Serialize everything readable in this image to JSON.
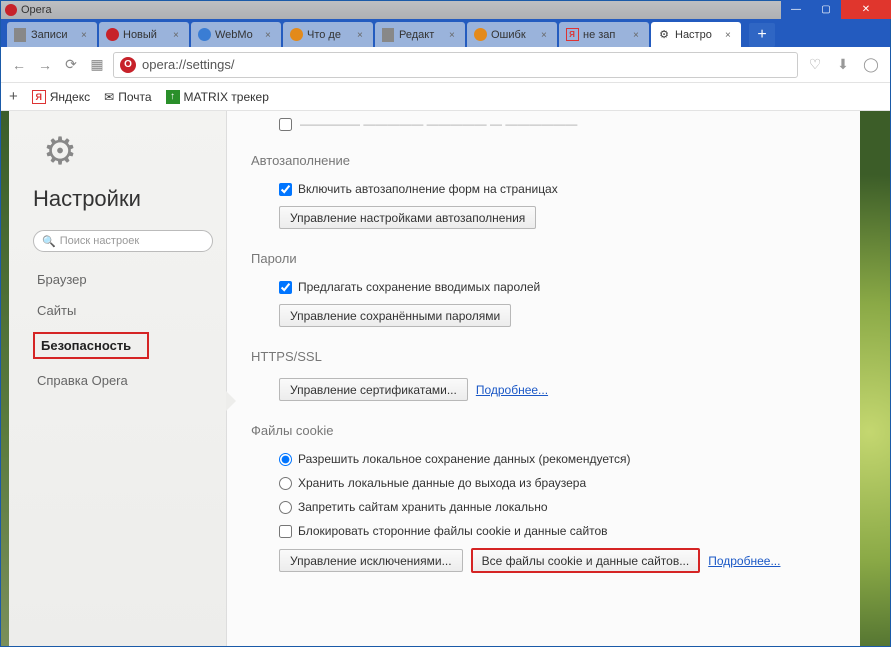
{
  "window": {
    "title": "Opera"
  },
  "tabs": [
    {
      "label": "Записи"
    },
    {
      "label": "Новый"
    },
    {
      "label": "WebMo"
    },
    {
      "label": "Что де"
    },
    {
      "label": "Редакт"
    },
    {
      "label": "Ошибк"
    },
    {
      "label": "не зап"
    },
    {
      "label": "Настро"
    }
  ],
  "addr": {
    "url": "opera://settings/"
  },
  "bookmarks": {
    "yandex": "Яндекс",
    "mail": "Почта",
    "matrix": "MATRIX трекер"
  },
  "sidebar": {
    "title": "Настройки",
    "search_placeholder": "Поиск настроек",
    "items": {
      "browser": "Браузер",
      "sites": "Сайты",
      "security": "Безопасность",
      "help": "Справка Opera"
    }
  },
  "sections": {
    "cutoff_label": "",
    "autofill": {
      "title": "Автозаполнение",
      "chk": "Включить автозаполнение форм на страницах",
      "btn": "Управление настройками автозаполнения"
    },
    "passwords": {
      "title": "Пароли",
      "chk": "Предлагать сохранение вводимых паролей",
      "btn": "Управление сохранёнными паролями"
    },
    "https": {
      "title": "HTTPS/SSL",
      "btn": "Управление сертификатами...",
      "more": "Подробнее..."
    },
    "cookies": {
      "title": "Файлы cookie",
      "opt1": "Разрешить локальное сохранение данных (рекомендуется)",
      "opt2": "Хранить локальные данные до выхода из браузера",
      "opt3": "Запретить сайтам хранить данные локально",
      "opt4": "Блокировать сторонние файлы cookie и данные сайтов",
      "btn1": "Управление исключениями...",
      "btn2": "Все файлы cookie и данные сайтов...",
      "more": "Подробнее..."
    }
  }
}
